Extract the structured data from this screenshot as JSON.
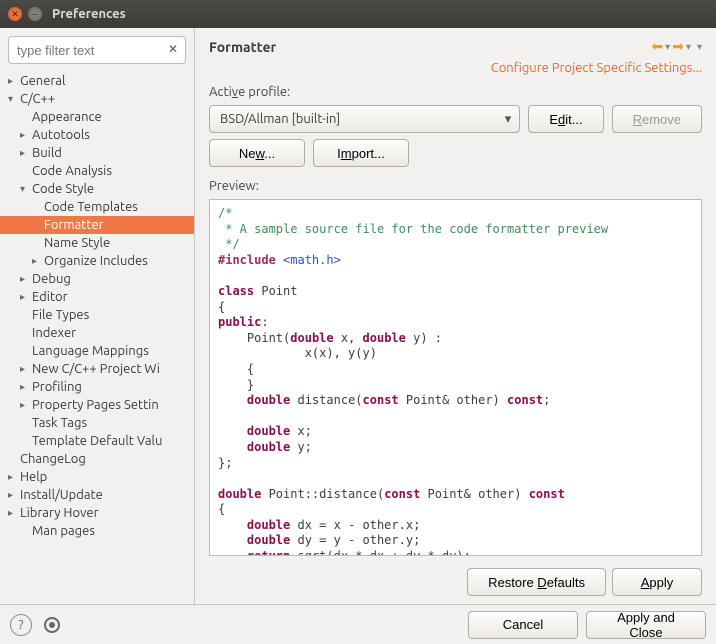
{
  "window": {
    "title": "Preferences"
  },
  "search": {
    "placeholder": "type filter text"
  },
  "tree": {
    "general": "General",
    "ccpp": "C/C++",
    "appearance": "Appearance",
    "autotools": "Autotools",
    "build": "Build",
    "codeanalysis": "Code Analysis",
    "codestyle": "Code Style",
    "codetemplates": "Code Templates",
    "formatter": "Formatter",
    "namestyle": "Name Style",
    "organizeincludes": "Organize Includes",
    "debug": "Debug",
    "editor": "Editor",
    "filetypes": "File Types",
    "indexer": "Indexer",
    "langmappings": "Language Mappings",
    "newprojwiz": "New C/C++ Project Wi",
    "profiling": "Profiling",
    "proppages": "Property Pages Settin",
    "tasktags": "Task Tags",
    "templatedefault": "Template Default Valu",
    "changelog": "ChangeLog",
    "help": "Help",
    "installupdate": "Install/Update",
    "libraryhover": "Library Hover",
    "manpages": "Man pages"
  },
  "main": {
    "heading": "Formatter",
    "configlink": "Configure Project Specific Settings...",
    "activeprofile_label": "Active profile:",
    "activeprofile_value": "BSD/Allman [built-in]",
    "edit": "Edit...",
    "remove": "Remove",
    "new": "New...",
    "import": "Import...",
    "preview_label": "Preview:",
    "restoredefaults": "Restore Defaults",
    "apply": "Apply"
  },
  "footer": {
    "cancel": "Cancel",
    "applyclose": "Apply and Close"
  },
  "code": {
    "l1": "/*",
    "l2": " * A sample source file for the code formatter preview",
    "l3": " */",
    "inc1": "#include",
    "inc2": " <math.h>",
    "class": "class",
    "point": " Point",
    "public": "public",
    "pointctor": "Point(",
    "dbl": "double",
    "xparm": " x, ",
    "yparm": " y) :",
    "init": "            x(x), y(y)",
    "dist1": " distance(",
    "const": "const",
    "other": " Point& other) ",
    "constend": "const",
    "semic": ";",
    "x": " x;",
    "y": " y;",
    "endclass": "};",
    "pdist": " Point::distance(",
    "lbr": "{",
    "rbr": "}",
    "dx": " dx = x - other.x;",
    "dy": " dy = y - other.y;",
    "ret": "return",
    "retexpr": " sqrt(dx * dx + dy * dy);"
  }
}
